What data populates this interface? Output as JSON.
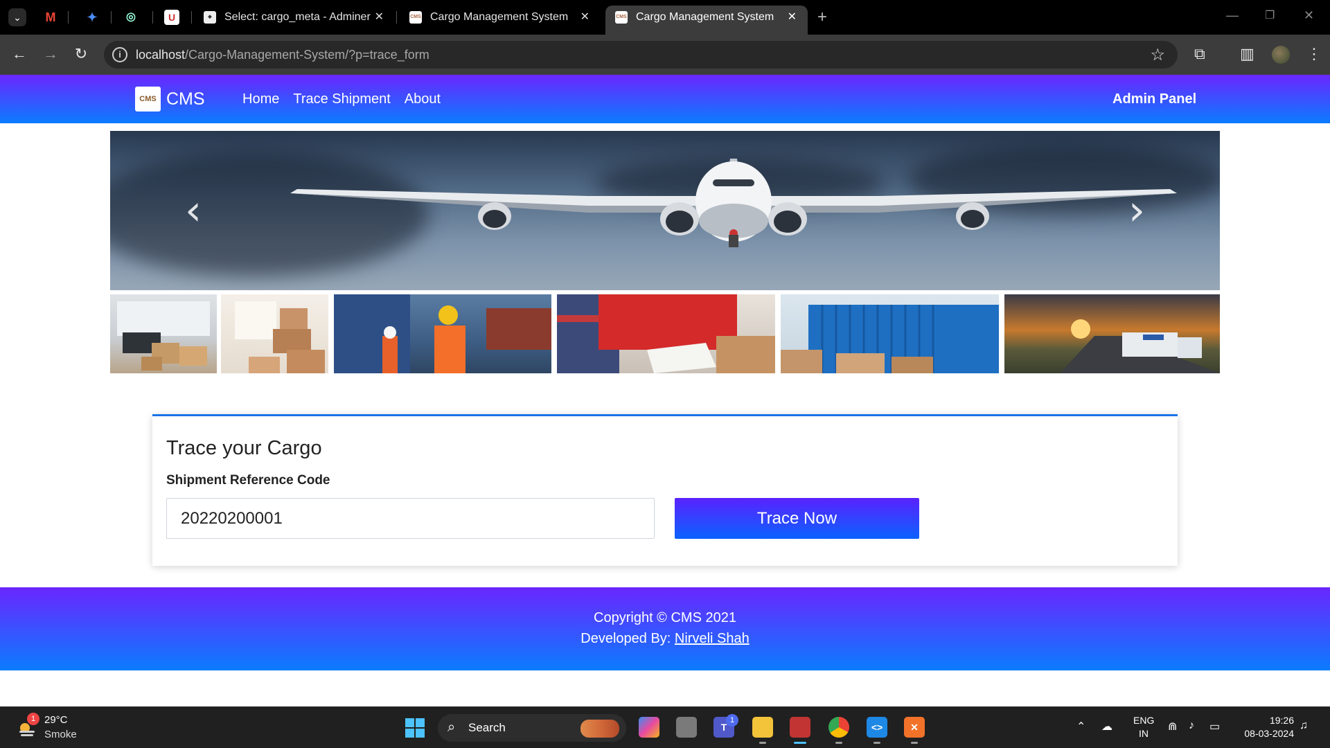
{
  "browser": {
    "tabs": [
      {
        "title": "Select: cargo_meta - Adminer",
        "active": false
      },
      {
        "title": "Cargo Management System",
        "active": false
      },
      {
        "title": "Cargo Management System",
        "active": true
      }
    ],
    "url_host": "localhost",
    "url_path": "/Cargo-Management-System/?p=trace_form"
  },
  "site": {
    "brand_logo_text": "CMS",
    "brand_name": "CMS",
    "nav": [
      "Home",
      "Trace Shipment",
      "About"
    ],
    "admin_link": "Admin Panel",
    "accent_colors": {
      "gradient_top": "#6a26ff",
      "gradient_bottom": "#0b7cff",
      "card_border": "#1a73e8"
    }
  },
  "carousel": {
    "prev_glyph": "‹",
    "next_glyph": "›",
    "thumbnails": [
      "office-boxes",
      "stacked-boxes",
      "container-yard-worker",
      "delivery-clipboard",
      "shipping-container",
      "truck-highway-sunset"
    ]
  },
  "trace": {
    "title": "Trace your Cargo",
    "field_label": "Shipment Reference Code",
    "field_value": "20220200001",
    "button_label": "Trace Now"
  },
  "footer": {
    "copyright": "Copyright © CMS 2021",
    "developed_by": "Developed By:",
    "developer": "Nirveli Shah"
  },
  "taskbar": {
    "weather_badge": "1",
    "weather_temp": "29°C",
    "weather_desc": "Smoke",
    "search_label": "Search",
    "teams_badge": "1",
    "lang_line1": "ENG",
    "lang_line2": "IN",
    "time": "19:26",
    "date": "08-03-2024"
  }
}
